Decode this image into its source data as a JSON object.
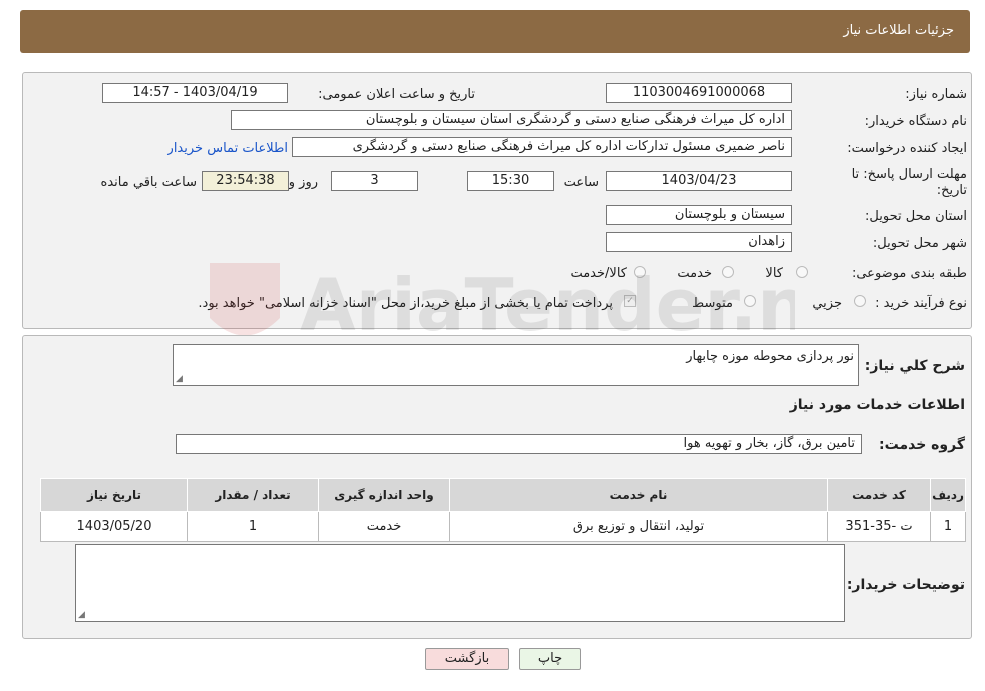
{
  "header": {
    "title": "جزئیات اطلاعات نیاز"
  },
  "form": {
    "need_number_label": "شماره نیاز:",
    "need_number": "1103004691000068",
    "announce_label": "تاریخ و ساعت اعلان عمومی:",
    "announce_value": "1403/04/19 - 14:57",
    "buyer_org_label": "نام دستگاه خریدار:",
    "buyer_org": "اداره کل میراث فرهنگی  صنایع دستی و گردشگری استان سیستان و بلوچستان",
    "creator_label": "ایجاد کننده درخواست:",
    "creator": "ناصر ضمیری مسئول تدارکات اداره کل میراث فرهنگی  صنایع دستی و گردشگری",
    "contact_link": "اطلاعات تماس خریدار",
    "deadline_label_1": "مهلت ارسال پاسخ: تا",
    "deadline_label_2": "تاریخ:",
    "deadline_date": "1403/04/23",
    "time_label": "ساعت",
    "deadline_time": "15:30",
    "days_value": "3",
    "days_label": "روز و",
    "remaining_time": "23:54:38",
    "remaining_label": "ساعت باقي مانده",
    "province_label": "استان محل تحویل:",
    "province": "سیستان و بلوچستان",
    "city_label": "شهر محل تحویل:",
    "city": "زاهدان",
    "category_label": "طبقه بندی موضوعی:",
    "category_options": [
      "کالا",
      "خدمت",
      "کالا/خدمت"
    ],
    "process_label": "نوع فرآیند خرید :",
    "process_options": [
      "جزیي",
      "متوسط"
    ],
    "payment_note": "پرداخت تمام یا بخشی از مبلغ خرید،از محل \"اسناد خزانه اسلامی\" خواهد بود."
  },
  "details": {
    "summary_label": "شرح کلي نیاز:",
    "summary": "نور پردازی محوطه موزه چابهار",
    "services_heading": "اطلاعات خدمات مورد نیاز",
    "group_label": "گروه خدمت:",
    "group_value": "تامین برق، گاز، بخار و تهویه هوا",
    "table": {
      "headers": [
        "ردیف",
        "کد خدمت",
        "نام خدمت",
        "واحد اندازه گیری",
        "تعداد / مقدار",
        "تاریخ نیاز"
      ],
      "rows": [
        [
          "1",
          "ت -35-351",
          "تولید، انتقال و توزیع برق",
          "خدمت",
          "1",
          "1403/05/20"
        ]
      ]
    },
    "buyer_notes_label": "توضیحات خریدار:"
  },
  "buttons": {
    "print": "چاپ",
    "back": "بازگشت"
  },
  "watermark": {
    "text": "AriaTender.neT"
  },
  "colors": {
    "header": "#8c6a44",
    "link": "#1a55c9",
    "back_button": "#f8dcdc",
    "print_button": "#eaf6e6"
  }
}
